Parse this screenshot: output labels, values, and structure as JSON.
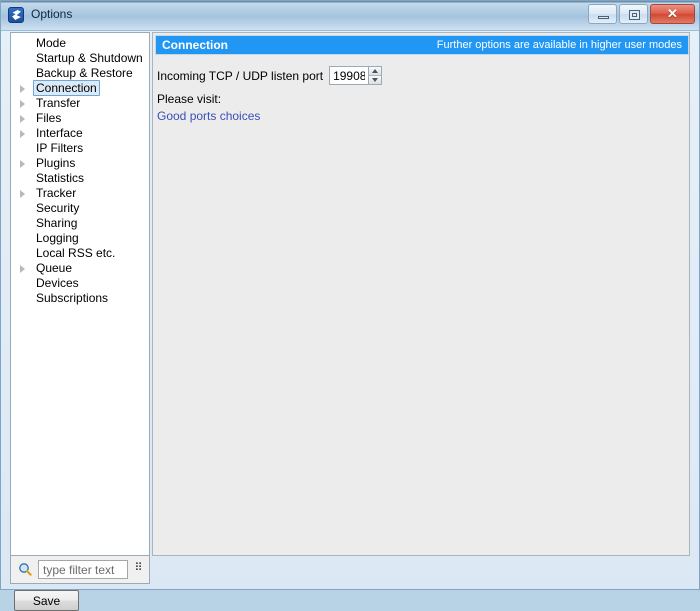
{
  "window": {
    "title": "Options",
    "icon": "vuze-logo-icon",
    "buttons": {
      "minimize": "minimize-icon",
      "maximize": "maximize-icon",
      "close": "✕"
    }
  },
  "sidebar": {
    "items": [
      {
        "label": "Mode",
        "expandable": false,
        "selected": false
      },
      {
        "label": "Startup & Shutdown",
        "expandable": false,
        "selected": false
      },
      {
        "label": "Backup & Restore",
        "expandable": false,
        "selected": false
      },
      {
        "label": "Connection",
        "expandable": true,
        "selected": true
      },
      {
        "label": "Transfer",
        "expandable": true,
        "selected": false
      },
      {
        "label": "Files",
        "expandable": true,
        "selected": false
      },
      {
        "label": "Interface",
        "expandable": true,
        "selected": false
      },
      {
        "label": "IP Filters",
        "expandable": false,
        "selected": false
      },
      {
        "label": "Plugins",
        "expandable": true,
        "selected": false
      },
      {
        "label": "Statistics",
        "expandable": false,
        "selected": false
      },
      {
        "label": "Tracker",
        "expandable": true,
        "selected": false
      },
      {
        "label": "Security",
        "expandable": false,
        "selected": false
      },
      {
        "label": "Sharing",
        "expandable": false,
        "selected": false
      },
      {
        "label": "Logging",
        "expandable": false,
        "selected": false
      },
      {
        "label": "Local RSS etc.",
        "expandable": false,
        "selected": false
      },
      {
        "label": "Queue",
        "expandable": true,
        "selected": false
      },
      {
        "label": "Devices",
        "expandable": false,
        "selected": false
      },
      {
        "label": "Subscriptions",
        "expandable": false,
        "selected": false
      }
    ],
    "filter": {
      "placeholder": "type filter text",
      "value": "",
      "menu_glyph": "⠿"
    }
  },
  "content": {
    "header": {
      "title": "Connection",
      "note": "Further options are available in higher user modes",
      "background": "#2196f3"
    },
    "port_field": {
      "label": "Incoming TCP / UDP listen port",
      "value": "19908"
    },
    "visit_label": "Please visit:",
    "link_text": "Good ports choices",
    "link_color": "#3b4fb8"
  },
  "footer": {
    "save_label": "Save"
  }
}
